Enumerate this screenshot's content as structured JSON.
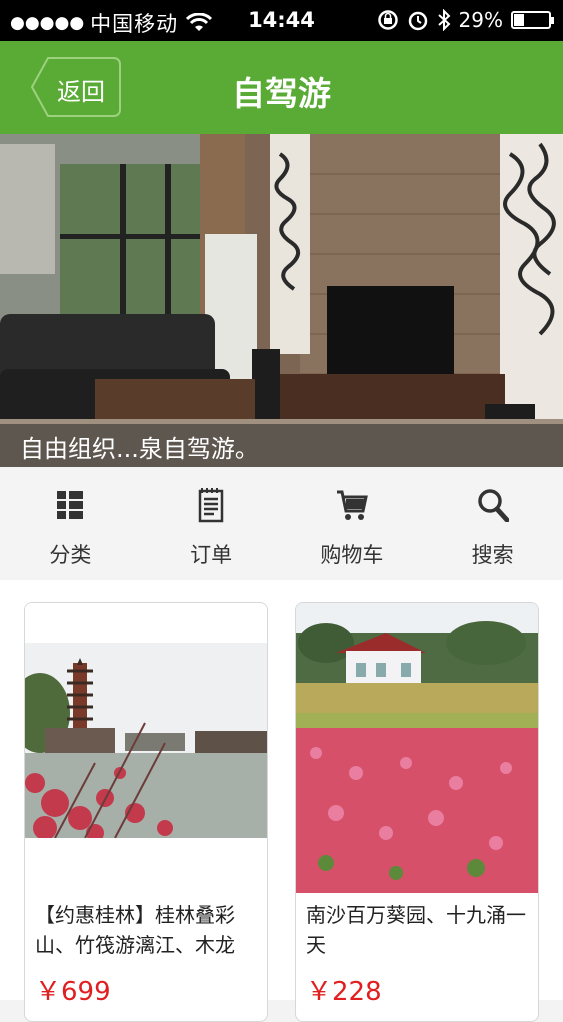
{
  "status_bar": {
    "signal_dots": "●●●●●",
    "carrier": "中国移动",
    "time": "14:44",
    "battery_percent": "29%",
    "battery_level": 0.29
  },
  "nav": {
    "back_label": "返回",
    "title": "自驾游"
  },
  "banner": {
    "caption": "自由组织...泉自驾游。"
  },
  "menu": [
    {
      "label": "分类",
      "icon": "grid-list-icon"
    },
    {
      "label": "订单",
      "icon": "receipt-icon"
    },
    {
      "label": "购物车",
      "icon": "cart-icon"
    },
    {
      "label": "搜索",
      "icon": "search-icon"
    }
  ],
  "products": [
    {
      "title": "【约惠桂林】桂林叠彩山、竹筏游漓江、木龙",
      "price": "￥699"
    },
    {
      "title": "南沙百万葵园、十九涌一天",
      "price": "￥228"
    }
  ],
  "colors": {
    "nav_green": "#5aab35",
    "price_red": "#e02020"
  }
}
